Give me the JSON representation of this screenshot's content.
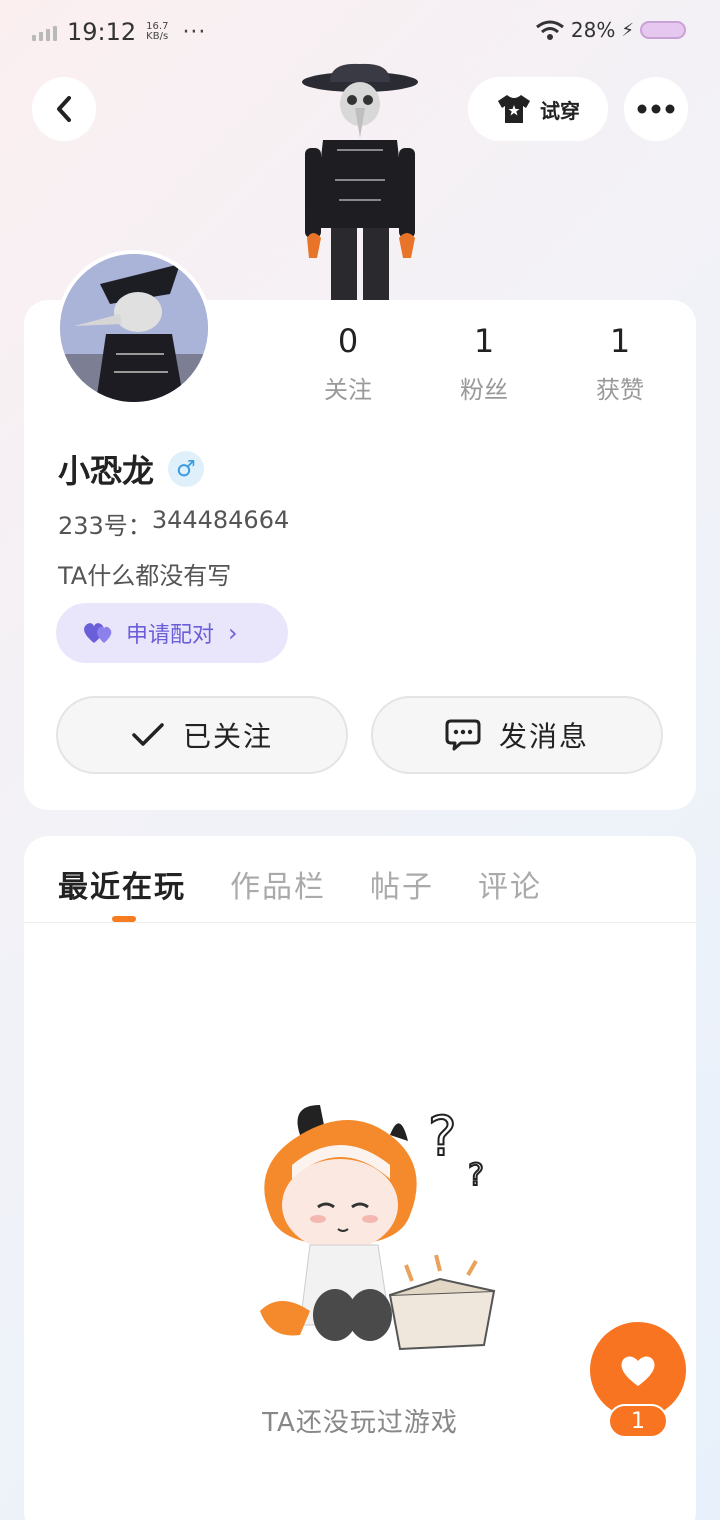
{
  "status_bar": {
    "time": "19:12",
    "net_speed_value": "16.7",
    "net_speed_unit": "KB/s",
    "dots": "···",
    "battery": "28%"
  },
  "header": {
    "tryon_label": "试穿"
  },
  "profile": {
    "stats": [
      {
        "value": "0",
        "label": "关注"
      },
      {
        "value": "1",
        "label": "粉丝"
      },
      {
        "value": "1",
        "label": "获赞"
      }
    ],
    "username": "小恐龙",
    "gender_symbol": "♂",
    "uid_label": "233号：",
    "uid": "344484664",
    "bio": "TA什么都没有写",
    "pair_label": "申请配对",
    "follow_label": "已关注",
    "message_label": "发消息"
  },
  "tabs": [
    {
      "label": "最近在玩",
      "active": true
    },
    {
      "label": "作品栏",
      "active": false
    },
    {
      "label": "帖子",
      "active": false
    },
    {
      "label": "评论",
      "active": false
    }
  ],
  "empty_state": {
    "text": "TA还没玩过游戏"
  },
  "like": {
    "count": "1"
  },
  "colors": {
    "accent": "#f87420",
    "pair": "#6b5ed9",
    "gender": "#3a9be0"
  }
}
